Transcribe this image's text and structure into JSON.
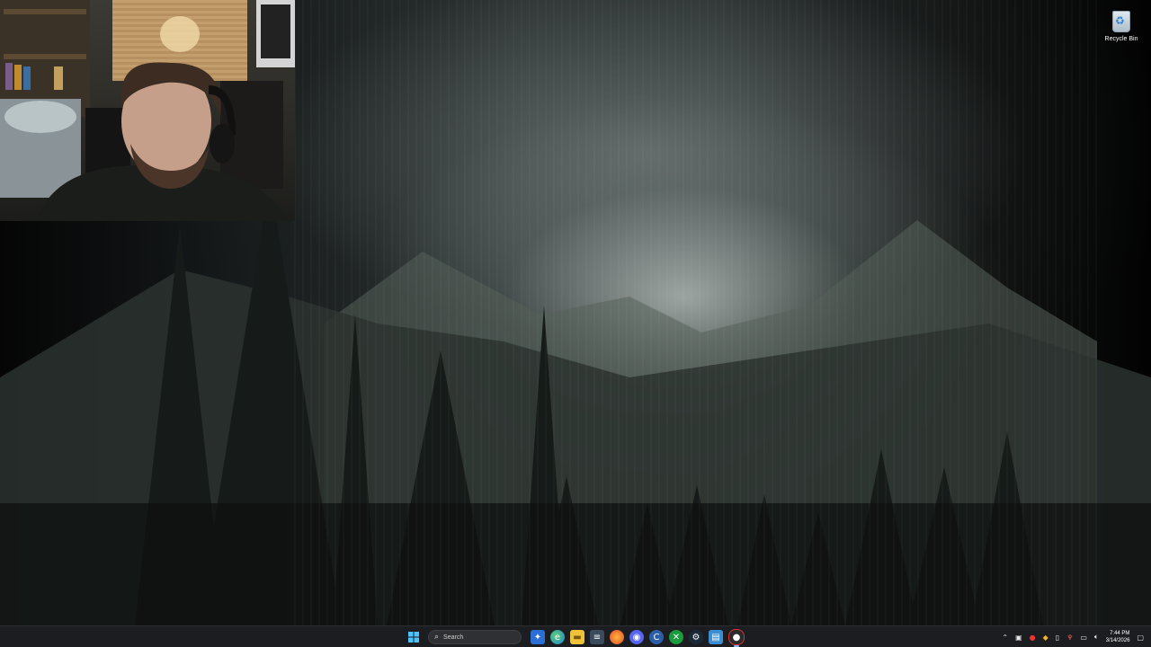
{
  "desktop": {
    "recycle_bin": {
      "label": "Recycle Bin",
      "icon": "recycle-bin-icon"
    }
  },
  "webcam": {
    "description_icon": "webcam-overlay"
  },
  "taskbar": {
    "start_icon": "windows-start-icon",
    "search": {
      "placeholder": "Search",
      "icon": "search-icon"
    },
    "pinned": [
      {
        "name": "copilot-icon"
      },
      {
        "name": "edge-icon"
      },
      {
        "name": "file-explorer-icon"
      },
      {
        "name": "notepad-icon"
      },
      {
        "name": "firefox-icon"
      },
      {
        "name": "discord-icon"
      },
      {
        "name": "ccleaner-icon"
      },
      {
        "name": "xbox-icon"
      },
      {
        "name": "steam-icon"
      },
      {
        "name": "notes-icon"
      },
      {
        "name": "obs-icon"
      }
    ],
    "tray": {
      "time": "7:44 PM",
      "date": "3/14/2026"
    }
  },
  "colors": {
    "taskbar_bg": "#1c1d20",
    "accent": "#8ab4f8"
  }
}
